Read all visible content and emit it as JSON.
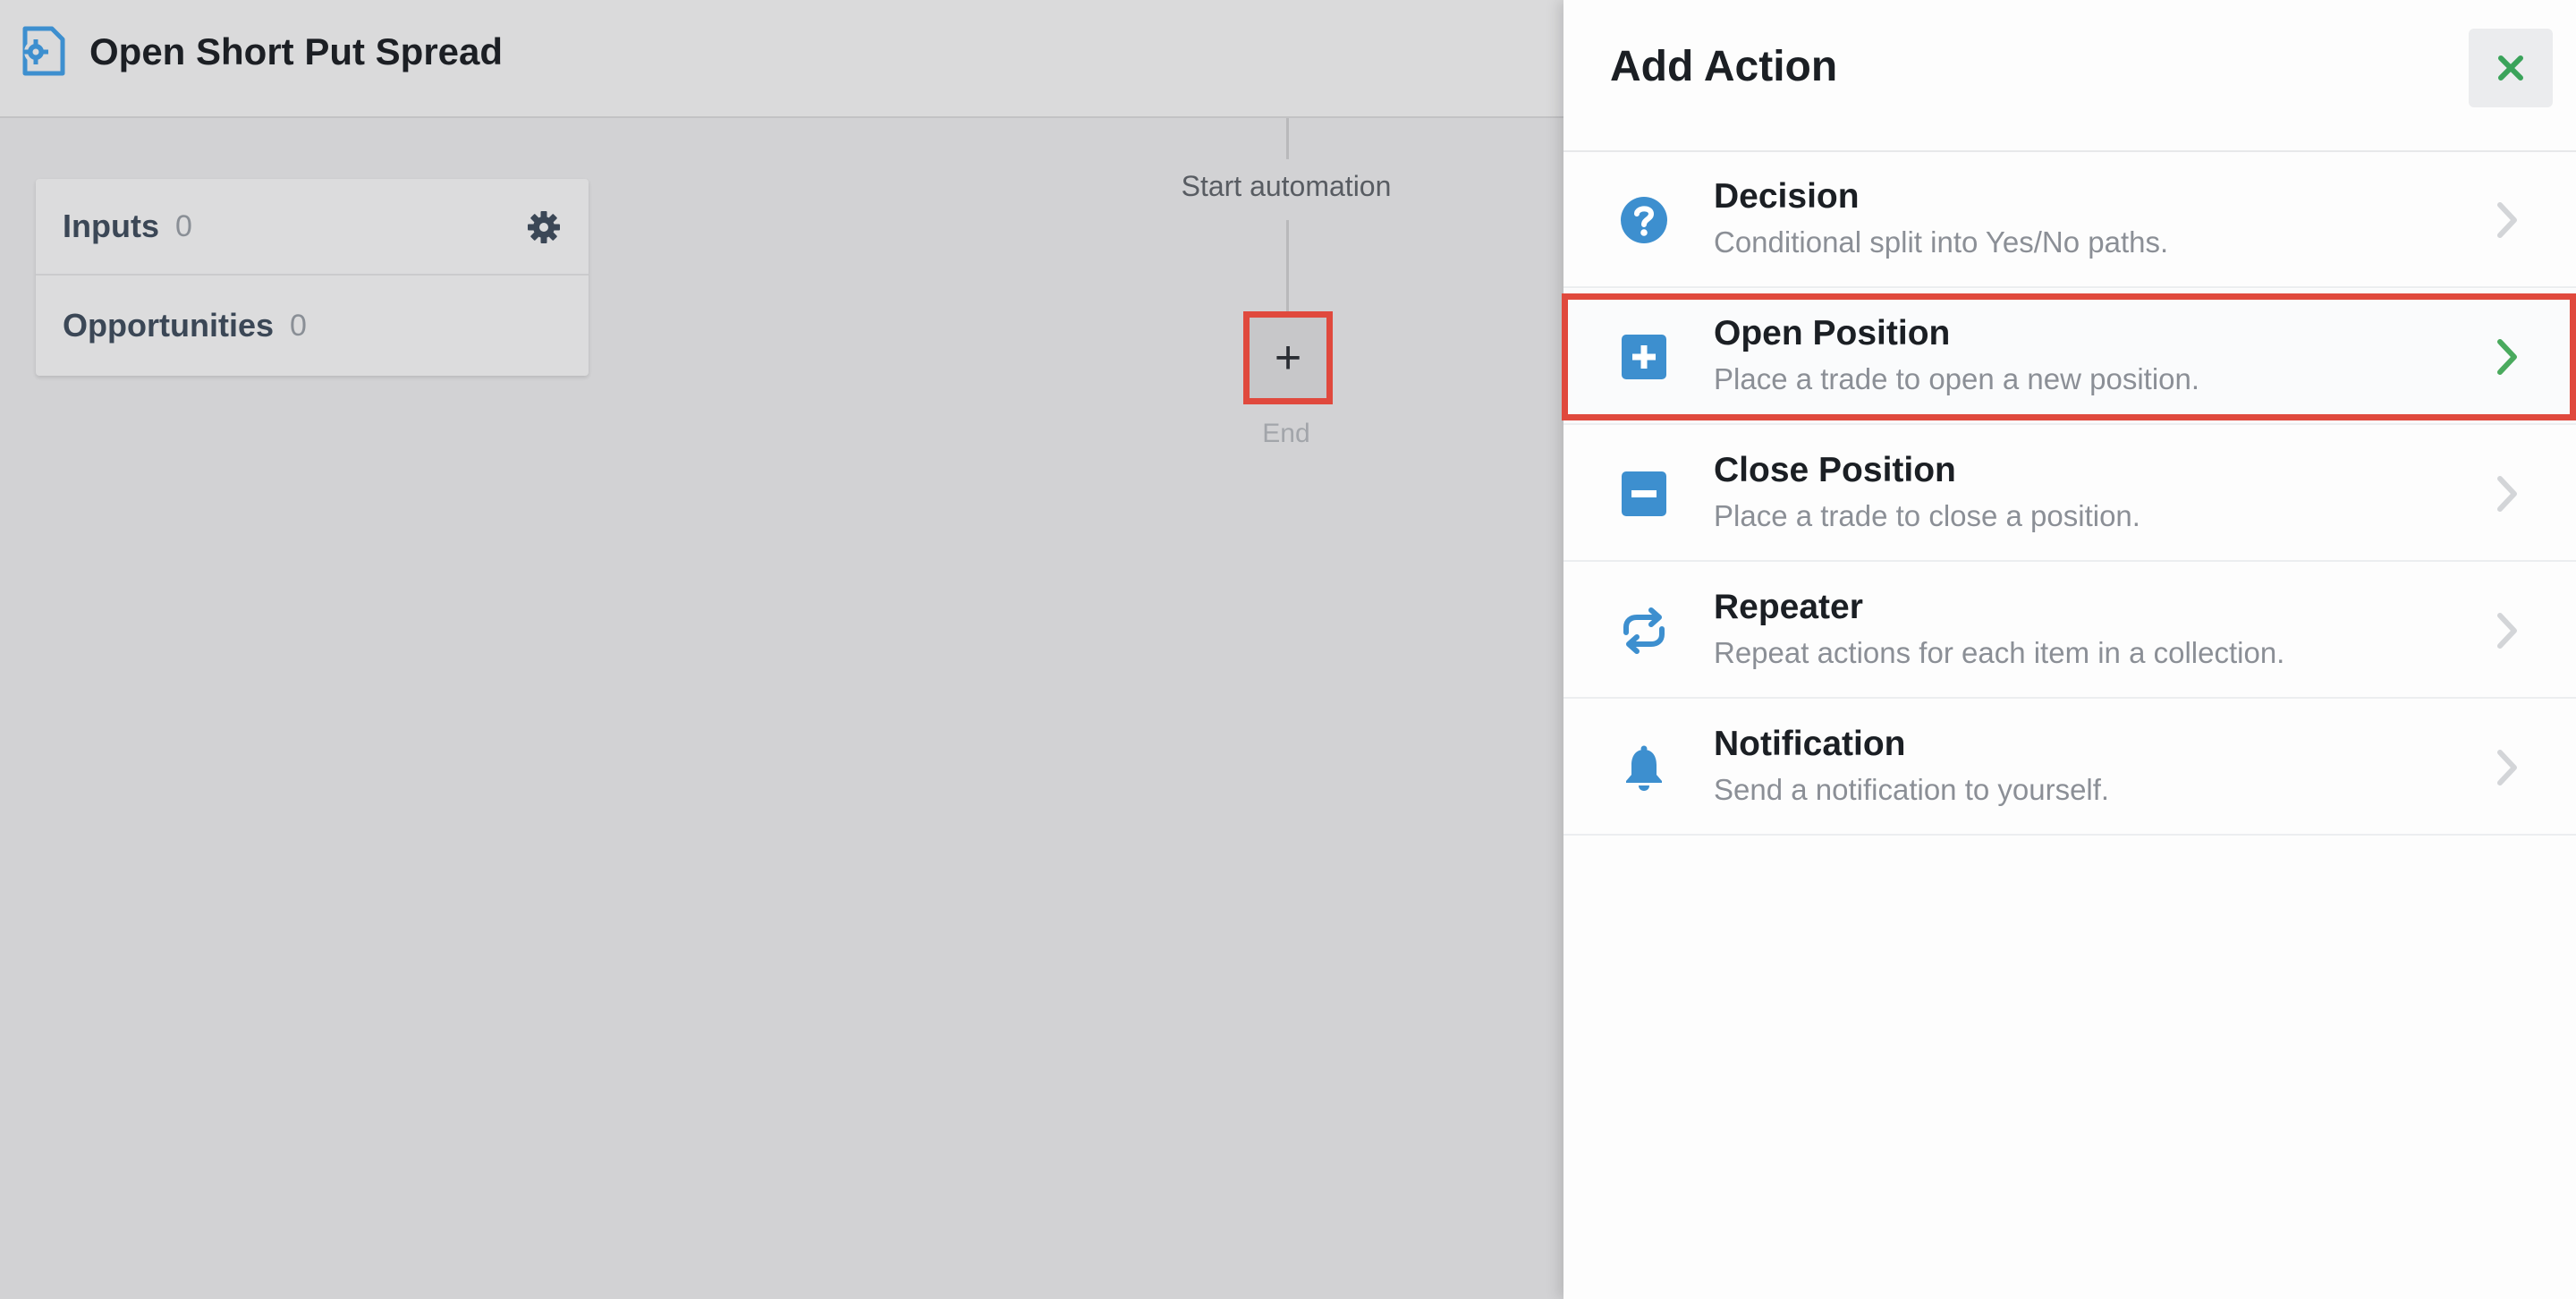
{
  "header": {
    "title": "Open Short Put Spread",
    "icon": "automation-gear-icon"
  },
  "sidebar_panel": {
    "rows": [
      {
        "label": "Inputs",
        "count": "0"
      },
      {
        "label": "Opportunities",
        "count": "0"
      }
    ]
  },
  "flow": {
    "start_label": "Start automation",
    "add_symbol": "+",
    "end_label": "End"
  },
  "drawer": {
    "title": "Add Action",
    "close_symbol": "✕",
    "actions": [
      {
        "title": "Decision",
        "description": "Conditional split into Yes/No paths.",
        "icon": "question-circle-icon"
      },
      {
        "title": "Open Position",
        "description": "Place a trade to open a new position.",
        "icon": "plus-square-icon",
        "selected": true
      },
      {
        "title": "Close Position",
        "description": "Place a trade to close a position.",
        "icon": "minus-square-icon"
      },
      {
        "title": "Repeater",
        "description": "Repeat actions for each item in a collection.",
        "icon": "repeat-icon"
      },
      {
        "title": "Notification",
        "description": "Send a notification to yourself.",
        "icon": "bell-icon"
      }
    ]
  },
  "colors": {
    "accent_blue": "#3d8fcf",
    "highlight_red": "#e0493d",
    "chevron_green": "#4aaa5e",
    "close_green": "#3aa35a"
  }
}
